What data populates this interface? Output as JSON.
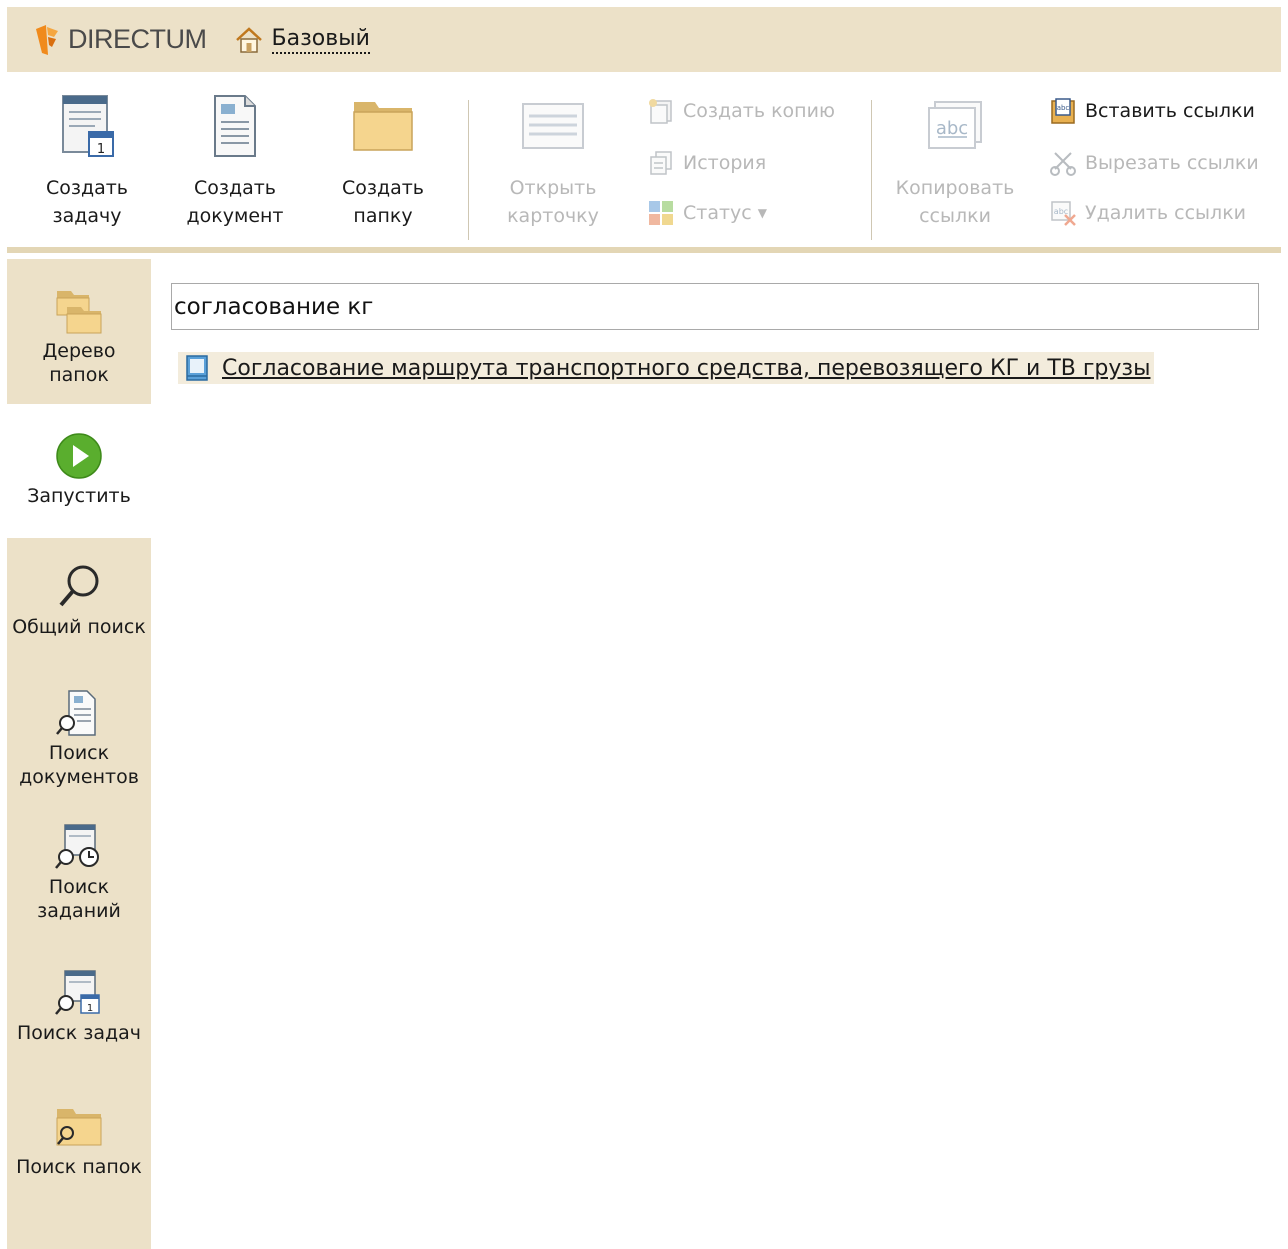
{
  "app": {
    "logo_text": "DIRECTUM",
    "home_label": "Базовый"
  },
  "ribbon": {
    "create_task": "Создать\nзадачу",
    "create_document": "Создать\nдокумент",
    "create_folder": "Создать\nпапку",
    "open_card": "Открыть\nкарточку",
    "create_copy": "Создать копию",
    "history": "История",
    "status": "Статус",
    "copy_links": "Копировать\nссылки",
    "insert_links": "Вставить ссылки",
    "cut_links": "Вырезать ссылки",
    "delete_links": "Удалить ссылки"
  },
  "sidebar": {
    "folder_tree": "Дерево\nпапок",
    "run": "Запустить",
    "general_search": "Общий поиск",
    "search_documents": "Поиск\nдокументов",
    "search_jobs": "Поиск\nзаданий",
    "search_tasks": "Поиск задач",
    "search_folders": "Поиск папок"
  },
  "search": {
    "value": "согласование кг"
  },
  "results": [
    {
      "title": "Согласование маршрута транспортного средства, перевозящего КГ и ТВ грузы"
    }
  ],
  "colors": {
    "panel_bg": "#ece1c8",
    "accent_orange": "#e8821e",
    "run_green": "#5aae2e",
    "disabled_text": "#b8b8b8"
  }
}
